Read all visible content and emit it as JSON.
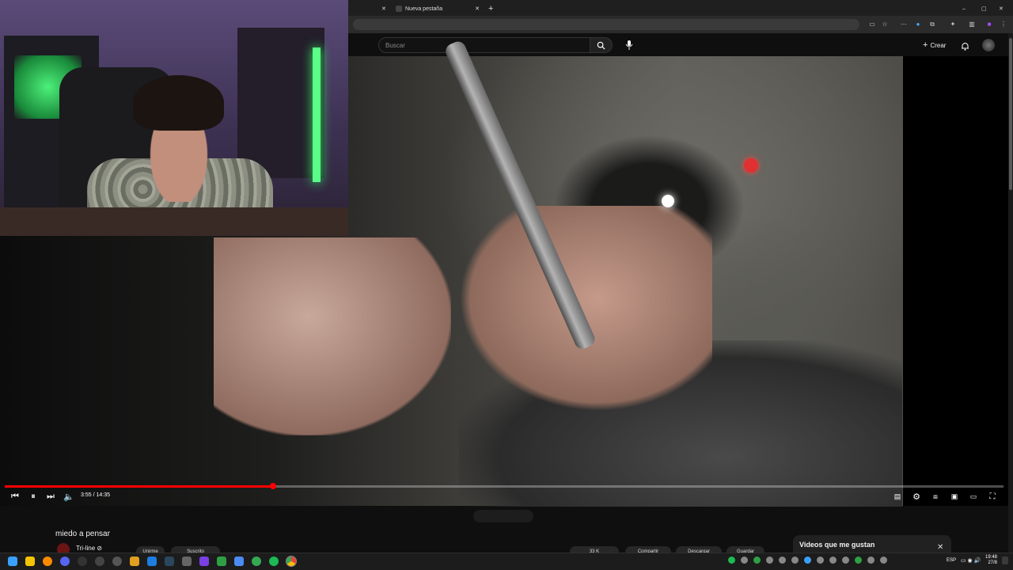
{
  "browser": {
    "tabs": [
      {
        "label": ""
      },
      {
        "label": "Nueva pestaña"
      }
    ],
    "new_tab_symbol": "+",
    "window_controls": [
      "–",
      "▢",
      "✕"
    ]
  },
  "youtube": {
    "search_placeholder": "Buscar",
    "create_label": "Crear",
    "player": {
      "current_time": "3:55",
      "duration": "14:35",
      "time_display": "3:55 / 14:35",
      "progress_fraction": 0.269
    },
    "video_title": "miedo a pensar",
    "channel_name": "Tri-line ⊘",
    "liked_panel_title": "Videos que me gustan",
    "action_pills": [
      "Unirme",
      "Suscrito",
      "33 K",
      "Compartir",
      "Descargar",
      "Guardar"
    ]
  },
  "taskbar": {
    "language": "ESP",
    "time": "19:48",
    "date": "27/8"
  },
  "colors": {
    "progress": "#ff0000",
    "background": "#0f0f0f",
    "taskbar": "#1c1c1c"
  }
}
